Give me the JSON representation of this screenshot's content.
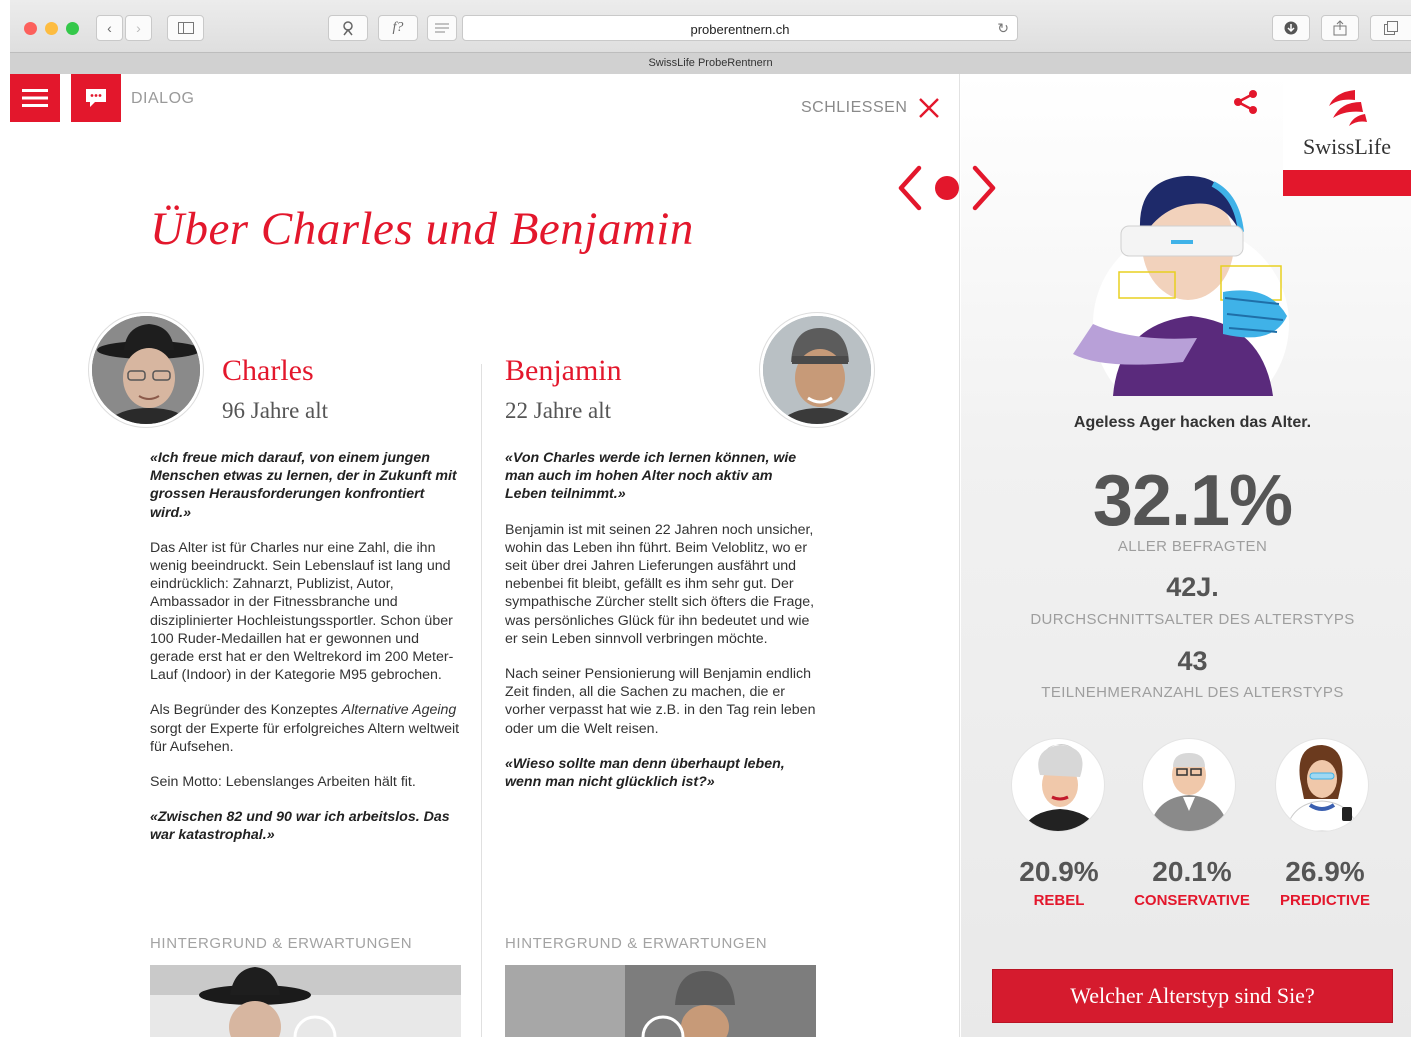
{
  "browser": {
    "url": "proberentnern.ch",
    "tab_title": "SwissLife ProbeRentnern",
    "reader_glyph": "f?"
  },
  "header": {
    "dialog_label": "DIALOG",
    "close_label": "SCHLIESSEN"
  },
  "page": {
    "title": "Über Charles und Benjamin"
  },
  "charles": {
    "name": "Charles",
    "age": "96 Jahre alt",
    "quote1": "«Ich freue mich darauf, von einem jungen Menschen etwas zu lernen, der in Zukunft mit grossen Herausforderungen konfrontiert wird.»",
    "p1": "Das Alter ist für Charles nur eine Zahl, die ihn wenig beeindruckt. Sein Lebenslauf ist lang und eindrücklich: Zahnarzt, Publizist, Autor, Ambassador in der Fitnessbranche und disziplinierter Hochleistungssportler. Schon über 100 Ruder-Medaillen hat er gewonnen und gerade erst hat er den Weltrekord im 200 Meter-Lauf (Indoor) in der Kategorie M95 gebrochen.",
    "p2_before": "Als Begründer des Konzeptes ",
    "p2_em": "Alternative Ageing",
    "p2_after": " sorgt der Experte für erfolgreiches Altern weltweit für Aufsehen.",
    "p3": "Sein Motto: Lebenslanges Arbeiten hält fit.",
    "quote2": "«Zwischen 82 und 90 war ich arbeitslos. Das war katastrophal.»",
    "section_heading": "HINTERGRUND & ERWARTUNGEN"
  },
  "benjamin": {
    "name": "Benjamin",
    "age": "22 Jahre alt",
    "quote1": "«Von Charles werde ich lernen können, wie man auch im hohen Alter noch aktiv am Leben teilnimmt.»",
    "p1": "Benjamin ist mit seinen 22 Jahren noch unsicher, wohin das Leben ihn führt. Beim Veloblitz, wo er seit über drei Jahren Lieferungen ausfährt und nebenbei fit bleibt, gefällt es ihm sehr gut. Der sympathische Zürcher stellt sich öfters die Frage, was persönliches Glück für ihn bedeutet und wie er sein Leben sinnvoll verbringen möchte.",
    "p2": "Nach seiner Pensionierung will Benjamin endlich Zeit finden, all die Sachen zu machen, die er vorher verpasst hat wie z.B. in den Tag rein leben oder um die Welt reisen.",
    "quote2": "«Wieso sollte man denn überhaupt leben, wenn man nicht glücklich ist?»",
    "section_heading": "HINTERGRUND & ERWARTUNGEN"
  },
  "sidebar": {
    "logo_text": "SwissLife",
    "hero_caption": "Ageless Ager hacken das Alter.",
    "main_percent": "32.1%",
    "main_percent_label": "ALLER BEFRAGTEN",
    "avg_age": "42J.",
    "avg_age_label": "DURCHSCHNITTSALTER DES ALTERSTYPS",
    "participants": "43",
    "participants_label": "TEILNEHMERANZAHL DES ALTERSTYPS",
    "types": [
      {
        "percent": "20.9%",
        "name": "REBEL"
      },
      {
        "percent": "20.1%",
        "name": "CONSERVATIVE"
      },
      {
        "percent": "26.9%",
        "name": "PREDICTIVE"
      }
    ],
    "cta_label": "Welcher Alterstyp sind Sie?"
  },
  "colors": {
    "brand_red": "#e3172c",
    "text_dark": "#333333",
    "text_muted": "#9e9e9e"
  },
  "icons": [
    "menu-icon",
    "chat-icon",
    "close-icon",
    "share-icon",
    "carousel-arrows-icon",
    "swisslife-logo-icon"
  ]
}
